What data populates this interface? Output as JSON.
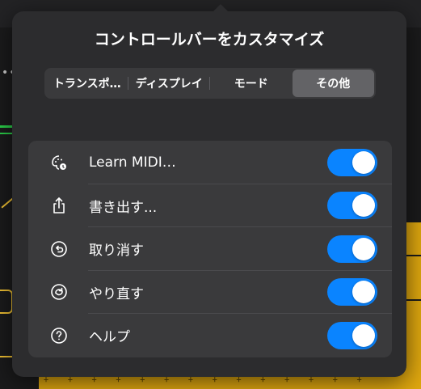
{
  "popover": {
    "title": "コントロールバーをカスタマイズ"
  },
  "segments": [
    {
      "label": "トランスポ…",
      "selected": false
    },
    {
      "label": "ディスプレイ",
      "selected": false
    },
    {
      "label": "モード",
      "selected": false
    },
    {
      "label": "その他",
      "selected": true
    }
  ],
  "items": [
    {
      "label": "Learn MIDI…",
      "icon": "learn-midi-icon",
      "enabled": true
    },
    {
      "label": "書き出す...",
      "icon": "share-icon",
      "enabled": true
    },
    {
      "label": "取り消す",
      "icon": "undo-icon",
      "enabled": true
    },
    {
      "label": "やり直す",
      "icon": "redo-icon",
      "enabled": true
    },
    {
      "label": "ヘルプ",
      "icon": "help-icon",
      "enabled": true
    }
  ],
  "colors": {
    "toggle_on": "#0a84ff",
    "popover_bg": "#2c2c2e",
    "list_bg": "#3a3a3c"
  }
}
